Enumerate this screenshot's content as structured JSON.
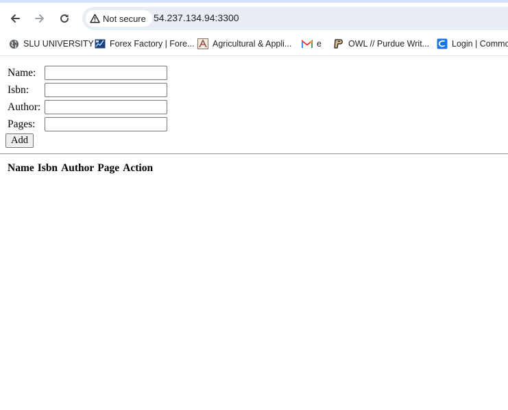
{
  "browser": {
    "security_label": "Not secure",
    "url": "54.237.134.94:3300",
    "bookmarks": [
      {
        "label": "SLU UNIVERSITY",
        "icon": "globe-icon"
      },
      {
        "label": "Forex Factory | Fore...",
        "icon": "forex-factory-icon"
      },
      {
        "label": "Agricultural & Appli...",
        "icon": "agricultural-icon"
      },
      {
        "label": "e",
        "icon": "gmail-icon"
      },
      {
        "label": "OWL // Purdue Writ...",
        "icon": "purdue-icon"
      },
      {
        "label": "Login | Commo",
        "icon": "commonapp-icon"
      }
    ],
    "colors": {
      "chrome_top": "#d3e3fd",
      "omnibox": "#e9eef6"
    }
  },
  "form": {
    "name_label": "Name:",
    "isbn_label": "Isbn:",
    "author_label": "Author:",
    "pages_label": "Pages:",
    "name_value": "",
    "isbn_value": "",
    "author_value": "",
    "pages_value": "",
    "add_label": "Add"
  },
  "table": {
    "headers": [
      "Name",
      "Isbn",
      "Author",
      "Page",
      "Action"
    ]
  }
}
